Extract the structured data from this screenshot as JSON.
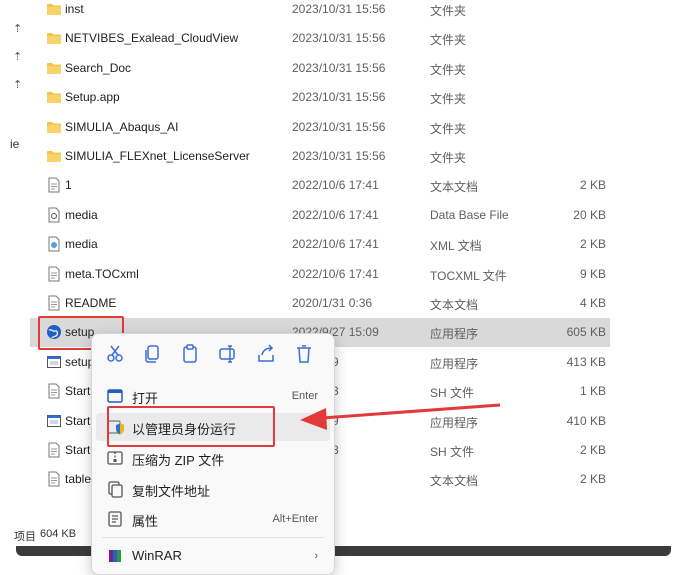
{
  "nav": {
    "glyphs": [
      "⇡",
      "⇡",
      "⇡"
    ],
    "partial_label": "ie"
  },
  "files": [
    {
      "name": "inst",
      "date": "2023/10/31 15:56",
      "type": "文件夹",
      "size": "",
      "kind": "folder"
    },
    {
      "name": "NETVIBES_Exalead_CloudView",
      "date": "2023/10/31 15:56",
      "type": "文件夹",
      "size": "",
      "kind": "folder"
    },
    {
      "name": "Search_Doc",
      "date": "2023/10/31 15:56",
      "type": "文件夹",
      "size": "",
      "kind": "folder"
    },
    {
      "name": "Setup.app",
      "date": "2023/10/31 15:56",
      "type": "文件夹",
      "size": "",
      "kind": "folder"
    },
    {
      "name": "SIMULIA_Abaqus_AI",
      "date": "2023/10/31 15:56",
      "type": "文件夹",
      "size": "",
      "kind": "folder"
    },
    {
      "name": "SIMULIA_FLEXnet_LicenseServer",
      "date": "2023/10/31 15:56",
      "type": "文件夹",
      "size": "",
      "kind": "folder"
    },
    {
      "name": "1",
      "date": "2022/10/6 17:41",
      "type": "文本文档",
      "size": "2 KB",
      "kind": "doc"
    },
    {
      "name": "media",
      "date": "2022/10/6 17:41",
      "type": "Data Base File",
      "size": "20 KB",
      "kind": "db"
    },
    {
      "name": "media",
      "date": "2022/10/6 17:41",
      "type": "XML 文档",
      "size": "2 KB",
      "kind": "xml"
    },
    {
      "name": "meta.TOCxml",
      "date": "2022/10/6 17:41",
      "type": "TOCXML 文件",
      "size": "9 KB",
      "kind": "doc"
    },
    {
      "name": "README",
      "date": "2020/1/31 0:36",
      "type": "文本文档",
      "size": "4 KB",
      "kind": "doc"
    },
    {
      "name": "setup",
      "date": "2022/9/27 15:09",
      "type": "应用程序",
      "size": "605 KB",
      "kind": "globe"
    },
    {
      "name": "setup",
      "date": "27 15:09",
      "type": "应用程序",
      "size": "413 KB",
      "kind": "app"
    },
    {
      "name": "Start",
      "date": "26 19:23",
      "type": "SH 文件",
      "size": "1 KB",
      "kind": "doc"
    },
    {
      "name": "Start",
      "date": "27 15:09",
      "type": "应用程序",
      "size": "410 KB",
      "kind": "app"
    },
    {
      "name": "Start",
      "date": "26 19:23",
      "type": "SH 文件",
      "size": "2 KB",
      "kind": "doc"
    },
    {
      "name": "table",
      "date": "/6 17:32",
      "type": "文本文档",
      "size": "2 KB",
      "kind": "doc"
    }
  ],
  "status": {
    "items_partial": "项目",
    "selected_size": "604 KB"
  },
  "context_menu": {
    "toolbar": [
      {
        "name": "cut-icon"
      },
      {
        "name": "copy-icon"
      },
      {
        "name": "paste-icon"
      },
      {
        "name": "rename-icon"
      },
      {
        "name": "share-icon"
      },
      {
        "name": "delete-icon"
      }
    ],
    "items": [
      {
        "label": "打开",
        "shortcut": "Enter",
        "icon": "open-window-icon"
      },
      {
        "label": "以管理员身份运行",
        "shortcut": "",
        "icon": "shield-icon"
      },
      {
        "label": "压缩为 ZIP 文件",
        "shortcut": "",
        "icon": "zip-icon"
      },
      {
        "label": "复制文件地址",
        "shortcut": "",
        "icon": "copy-path-icon"
      },
      {
        "label": "属性",
        "shortcut": "Alt+Enter",
        "icon": "properties-icon"
      },
      {
        "label": "WinRAR",
        "shortcut": "›",
        "icon": "winrar-icon"
      }
    ]
  },
  "colors": {
    "highlight": "#e23a3a",
    "folder": "#f4c34b",
    "selected_row": "#d9d9d9"
  }
}
